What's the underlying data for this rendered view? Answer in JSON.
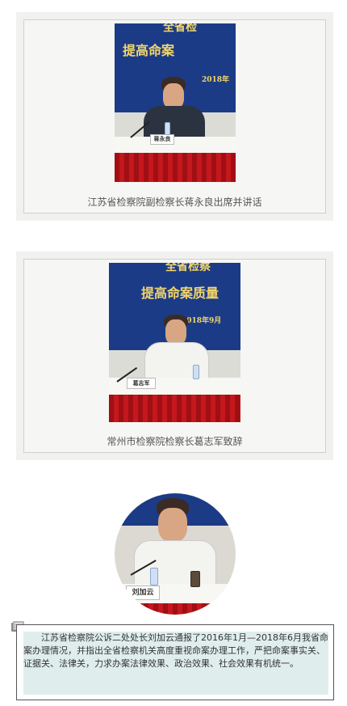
{
  "cards": [
    {
      "caption": "江苏省检察院副检察长蒋永良出席并讲话",
      "banner_line1": "全省检",
      "banner_line2": "提高命案",
      "banner_date": "2018年",
      "nameplate": "蒋永良"
    },
    {
      "caption": "常州市检察院检察长葛志军致辞",
      "banner_line1": "全省检察",
      "banner_line2": "提高命案质量",
      "banner_date": "2018年9月",
      "nameplate": "葛志军"
    }
  ],
  "portrait": {
    "nameplate": "刘加云"
  },
  "note": {
    "text": "江苏省检察院公诉二处处长刘加云通报了2016年1月—2018年6月我省命案办理情况，并指出全省检察机关高度重视命案办理工作，严把命案事实关、证据关、法律关，力求办案法律效果、政治效果、社会效果有机统一。"
  },
  "colors": {
    "banner_blue": "#1c3b86",
    "curtain_red": "#c5171d",
    "note_bg": "#dfeeed"
  }
}
